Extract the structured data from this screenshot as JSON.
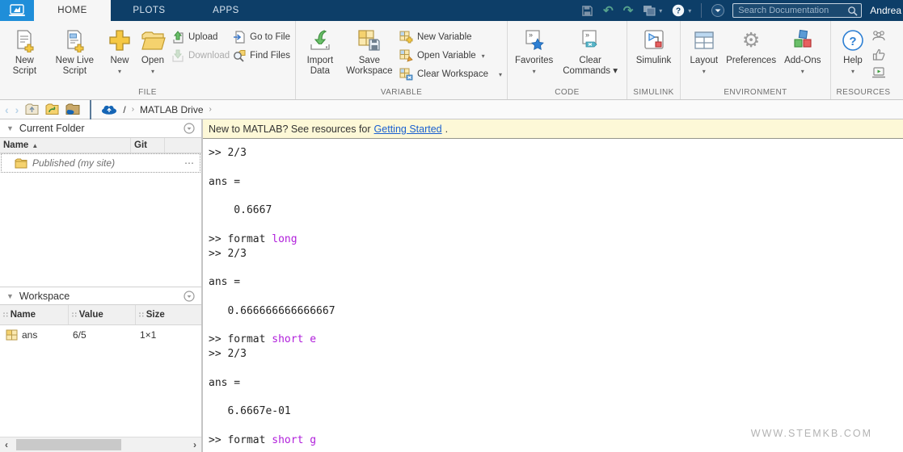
{
  "topbar": {
    "tabs": [
      {
        "label": "HOME",
        "active": true
      },
      {
        "label": "PLOTS",
        "active": false
      },
      {
        "label": "APPS",
        "active": false
      }
    ],
    "search_placeholder": "Search Documentation",
    "username": "Andrea"
  },
  "ribbon": {
    "file": {
      "label": "FILE",
      "new_script": "New Script",
      "new_live_script": "New Live Script",
      "new": "New",
      "open": "Open",
      "upload": "Upload",
      "download": "Download",
      "go_to_file": "Go to File",
      "find_files": "Find Files"
    },
    "variable": {
      "label": "VARIABLE",
      "import_data": "Import Data",
      "save_workspace": "Save Workspace",
      "new_variable": "New Variable",
      "open_variable": "Open Variable",
      "clear_workspace": "Clear Workspace"
    },
    "code": {
      "label": "CODE",
      "favorites": "Favorites",
      "clear_commands": "Clear Commands"
    },
    "simulink": {
      "label": "SIMULINK",
      "simulink": "Simulink"
    },
    "environment": {
      "label": "ENVIRONMENT",
      "layout": "Layout",
      "preferences": "Preferences",
      "addons": "Add-Ons"
    },
    "resources": {
      "label": "RESOURCES",
      "help": "Help"
    }
  },
  "pathbar": {
    "root": "/",
    "sep": "›",
    "drive": "MATLAB Drive"
  },
  "current_folder": {
    "title": "Current Folder",
    "col_name": "Name",
    "col_git": "Git",
    "row": {
      "name": "Published",
      "suffix": "(my site)",
      "more": "⋯"
    }
  },
  "workspace": {
    "title": "Workspace",
    "col_name": "Name",
    "col_value": "Value",
    "col_size": "Size",
    "row": {
      "name": "ans",
      "value": "6/5",
      "size": "1×1"
    }
  },
  "notification": {
    "text": "New to MATLAB? See resources for",
    "link": "Getting Started",
    "period": "."
  },
  "terminal": {
    "lines": [
      {
        "segs": [
          {
            "t": ">> 2/3"
          }
        ]
      },
      {
        "segs": []
      },
      {
        "segs": [
          {
            "t": "ans ="
          }
        ]
      },
      {
        "segs": []
      },
      {
        "segs": [
          {
            "t": "    0.6667"
          }
        ]
      },
      {
        "segs": []
      },
      {
        "segs": [
          {
            "t": ">> format "
          },
          {
            "t": "long",
            "k": true
          }
        ]
      },
      {
        "segs": [
          {
            "t": ">> 2/3"
          }
        ]
      },
      {
        "segs": []
      },
      {
        "segs": [
          {
            "t": "ans ="
          }
        ]
      },
      {
        "segs": []
      },
      {
        "segs": [
          {
            "t": "   0.666666666666667"
          }
        ]
      },
      {
        "segs": []
      },
      {
        "segs": [
          {
            "t": ">> format "
          },
          {
            "t": "short e",
            "k": true
          }
        ]
      },
      {
        "segs": [
          {
            "t": ">> 2/3"
          }
        ]
      },
      {
        "segs": []
      },
      {
        "segs": [
          {
            "t": "ans ="
          }
        ]
      },
      {
        "segs": []
      },
      {
        "segs": [
          {
            "t": "   6.6667e-01"
          }
        ]
      },
      {
        "segs": []
      },
      {
        "segs": [
          {
            "t": ">> format "
          },
          {
            "t": "short g",
            "k": true
          }
        ]
      }
    ]
  },
  "watermark": "WWW.STEMKB.COM",
  "icons": {
    "caret_down": "▾",
    "collapse_triangle": "▼",
    "sort_ascending": "▲",
    "grip_dots": "∷",
    "more_ellipsis": "⋯",
    "scroll_left": "‹",
    "scroll_right": "›",
    "nav_back": "‹",
    "nav_forward": "›",
    "gear": "⚙",
    "undo": "↶",
    "redo": "↷"
  },
  "colors": {
    "topbar": "#0d3e68",
    "logo_tile": "#1f8ed9",
    "keyword": "#b01edb",
    "link": "#1a5fd0",
    "notification_bg": "#fdf8d7",
    "icon_yellow": "#f5c844",
    "icon_green": "#4caf50"
  }
}
